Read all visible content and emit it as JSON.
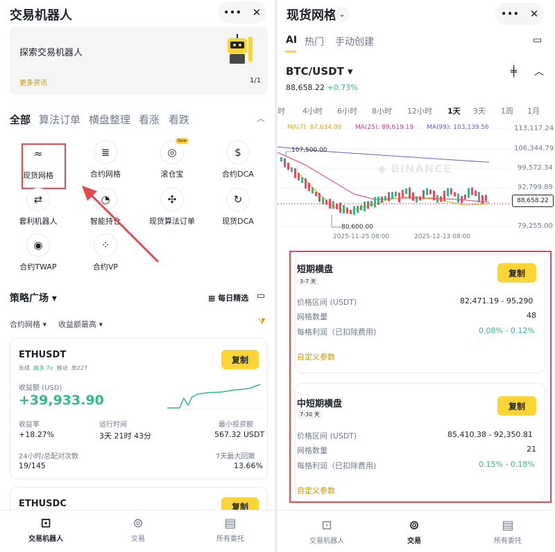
{
  "left": {
    "title": "交易机器人",
    "banner": {
      "text": "探索交易机器人",
      "more": "更多资讯",
      "page": "1/1"
    },
    "tabs": [
      "全部",
      "算法订单",
      "横盘整理",
      "看涨",
      "看跌"
    ],
    "tools": [
      {
        "label": "现货网格",
        "icon": "grid-chart-icon"
      },
      {
        "label": "合约网格",
        "icon": "futures-grid-icon"
      },
      {
        "label": "滚仓宝",
        "icon": "rollover-icon",
        "badge": "New"
      },
      {
        "label": "合约DCA",
        "icon": "futures-dca-icon"
      },
      {
        "label": "套利机器人",
        "icon": "arbitrage-icon"
      },
      {
        "label": "智能持仓",
        "icon": "portfolio-icon"
      },
      {
        "label": "现货算法订单",
        "icon": "algo-order-icon"
      },
      {
        "label": "现货DCA",
        "icon": "spot-dca-icon"
      },
      {
        "label": "合约TWAP",
        "icon": "twap-icon"
      },
      {
        "label": "合约VP",
        "icon": "vp-icon"
      }
    ],
    "strategy": {
      "title": "策略广场",
      "daily": "每日精选",
      "filter1": "合约网格",
      "filter2": "收益额最高"
    },
    "card1": {
      "symbol": "ETHUSDT",
      "tag1": "永续",
      "tag2": "做多 7x",
      "tag3": "移动",
      "tag4": "帛227",
      "copy": "复制",
      "pnl_label": "收益额 (USD)",
      "pnl": "+39,933.90",
      "roi_label": "收益率",
      "roi": "+18.27%",
      "time_label": "运行时间",
      "time": "3天 21时 43分",
      "min_label": "最小投资额",
      "min": "567.32 USDT",
      "match_label": "24小时/总配对次数",
      "match": "19/145",
      "dd_label": "7天最大回撤",
      "dd": "13.66%"
    },
    "card2": {
      "symbol": "ETHUSDC",
      "copy": "复制"
    },
    "nav": [
      "交易机器人",
      "交易",
      "所有委托"
    ]
  },
  "right": {
    "title": "现货网格",
    "tabs": [
      "AI",
      "热门",
      "手动创建"
    ],
    "pair": "BTC/USDT",
    "price": "88,658.22",
    "change": "+0.73%",
    "timeframes": [
      "时",
      "4小时",
      "6小时",
      "8小时",
      "12小时",
      "1天",
      "3天",
      "1周",
      "1月"
    ],
    "ma": {
      "ma7": "MA(7): 87,634.00",
      "ma25": "MA(25): 89,619.19",
      "ma99": "MA(99): 103,139.56"
    },
    "watermark": "BINANCE",
    "yaxis": [
      "113,117.24",
      "106,344.79",
      "99,572.34",
      "92,799.89",
      "88,658.22",
      "79,255.00"
    ],
    "annot_high": "107,500.00",
    "annot_low": "80,600.00",
    "dates": [
      "2025-11-25 08:00",
      "2025-12-13 08:00"
    ],
    "plan1": {
      "title": "短期横盘",
      "days": "3-7 天",
      "copy": "复制",
      "range_label": "价格区间 (USDT)",
      "range": "82,471.19 - 95,290",
      "grid_label": "网格数量",
      "grid": "48",
      "profit_label": "每格利润（已扣除费用)",
      "profit": "0.08% - 0.12%",
      "custom": "自定义参数"
    },
    "plan2": {
      "title": "中短期横盘",
      "days": "7-30 天",
      "copy": "复制",
      "range_label": "价格区间 (USDT)",
      "range": "85,410.38 - 92,350.81",
      "grid_label": "网格数量",
      "grid": "21",
      "profit_label": "每格利润（已扣除费用)",
      "profit": "0.15% - 0.18%",
      "custom": "自定义参数"
    },
    "nav": [
      "交易机器人",
      "交易",
      "所有委托"
    ]
  },
  "colors": {
    "accent": "#fcd535",
    "up": "#2ebd85",
    "down": "#f6465d",
    "highlight": "#e5484d"
  }
}
